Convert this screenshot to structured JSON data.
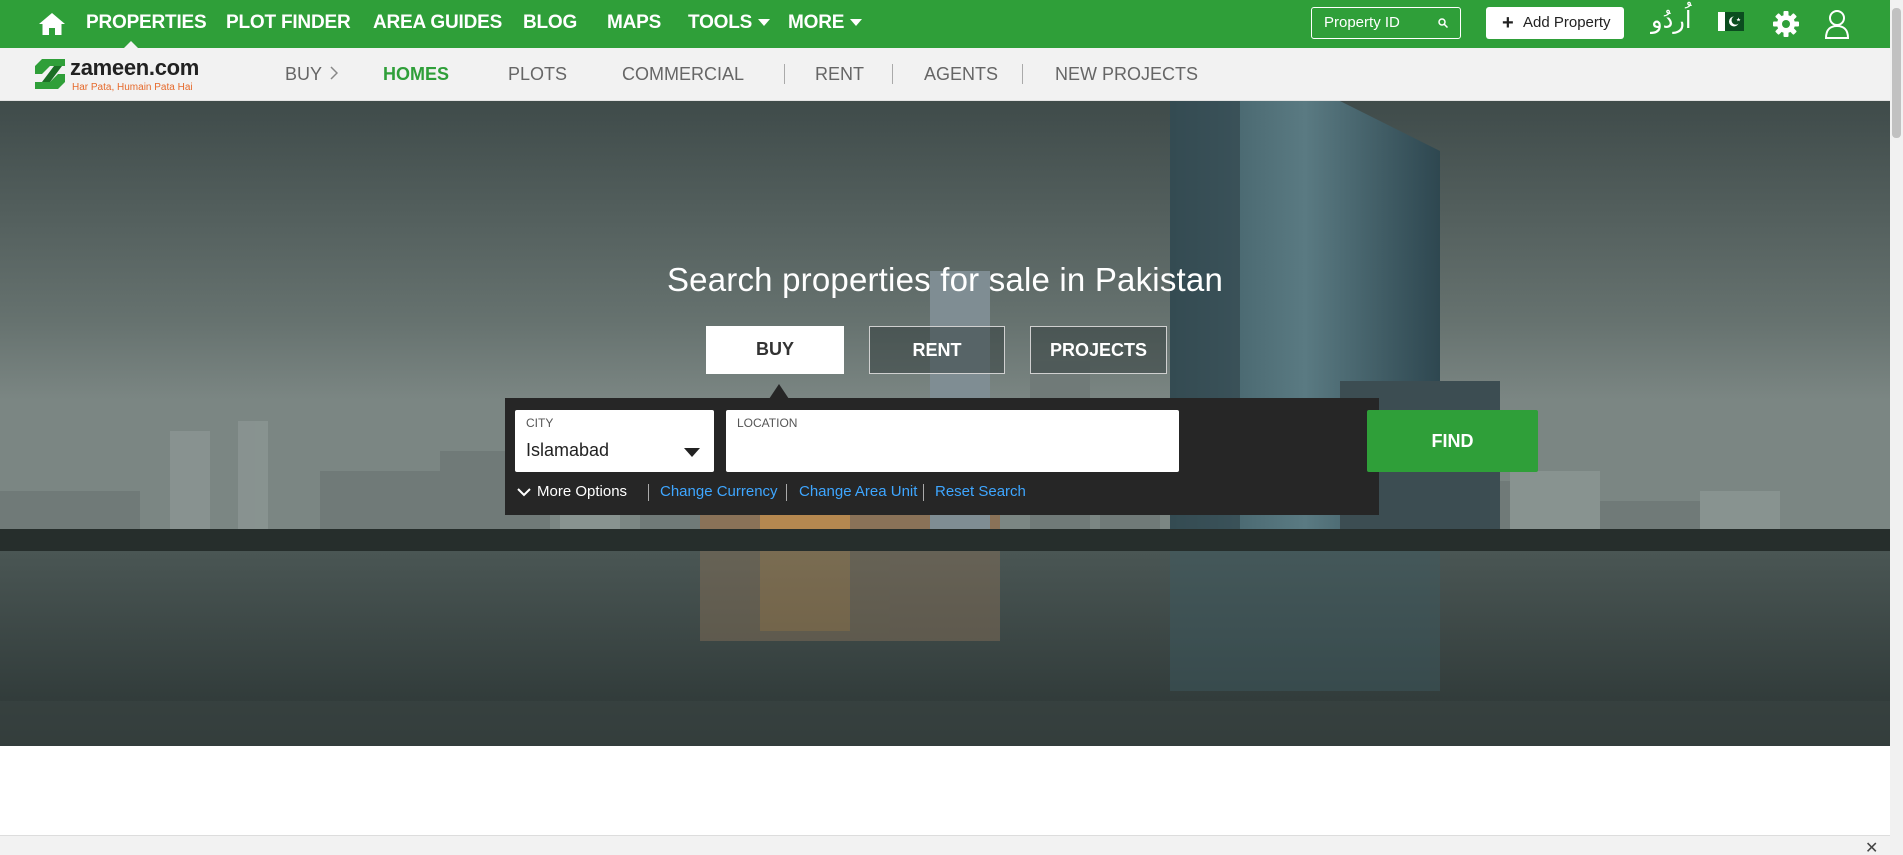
{
  "topbar": {
    "nav": [
      "PROPERTIES",
      "PLOT FINDER",
      "AREA GUIDES",
      "BLOG",
      "MAPS",
      "TOOLS",
      "MORE"
    ],
    "property_id_placeholder": "Property ID",
    "add_property": "Add Property",
    "language": "اُردُو",
    "brand_color": "#2f9f39"
  },
  "logo": {
    "name": "zameen.com",
    "tagline": "Har Pata, Humain Pata Hai"
  },
  "subnav": {
    "items": [
      "BUY",
      "HOMES",
      "PLOTS",
      "COMMERCIAL",
      "RENT",
      "AGENTS",
      "NEW PROJECTS"
    ],
    "active": "HOMES"
  },
  "hero": {
    "title": "Search properties for sale in Pakistan",
    "tabs": [
      "BUY",
      "RENT",
      "PROJECTS"
    ],
    "active_tab": "BUY",
    "city_label": "CITY",
    "city_value": "Islamabad",
    "location_label": "LOCATION",
    "location_value": "",
    "find_label": "FIND",
    "options": {
      "more": "More Options",
      "currency": "Change Currency",
      "area_unit": "Change Area Unit",
      "reset": "Reset Search"
    }
  },
  "footer_close": "✕"
}
